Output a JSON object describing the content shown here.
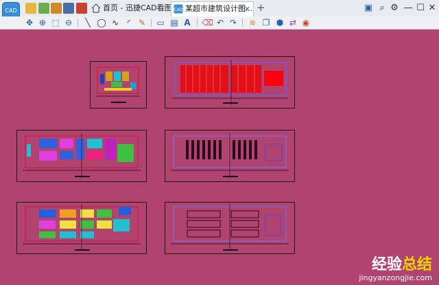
{
  "app": {
    "icon_text": "CAD"
  },
  "tabs": [
    {
      "label": "首页 - 迅捷CAD看图",
      "active": false
    },
    {
      "label": "某超市建筑设计图...",
      "active": true
    }
  ],
  "tab_close": "×",
  "new_tab": "+",
  "quick_access": [
    "open-folder-icon",
    "open-recent-icon",
    "save-icon",
    "print-icon",
    "settings-folder-icon"
  ],
  "window_controls": [
    "pin-icon",
    "zoom-icon",
    "settings-icon",
    "minimize",
    "maximize",
    "close"
  ],
  "window_glyphs": {
    "minimize": "—",
    "maximize": "☐",
    "close": "✕",
    "settings": "⚙",
    "zoom": "⌕",
    "pin": "▣"
  },
  "toolbar": [
    "pan-icon",
    "zoom-window-icon",
    "zoom-extents-icon",
    "zoom-realtime-icon",
    "line-icon",
    "circle-icon",
    "polyline-icon",
    "arc-icon",
    "pen-icon",
    "rectangle-icon",
    "layout-icon",
    "text-icon",
    "eraser-icon",
    "undo-icon",
    "redo-icon",
    "layers-icon",
    "copy-icon",
    "3d-icon",
    "match-icon",
    "color-wheel-icon"
  ],
  "toolbar_glyphs": [
    "✥",
    "⊕",
    "⬚",
    "⊖",
    "╲",
    "◯",
    "∿",
    "◜",
    "✎",
    "▭",
    "▤",
    "A",
    "⌫",
    "↶",
    "↷",
    "≋",
    "❐",
    "⬢",
    "⇄",
    "◉"
  ],
  "colors": {
    "canvas": "#b0446f",
    "sheet_border": "#1b0a12"
  },
  "watermark": {
    "cn_main": "经验",
    "cn_accent": "总结",
    "url": "jingyanzongjie.com"
  }
}
